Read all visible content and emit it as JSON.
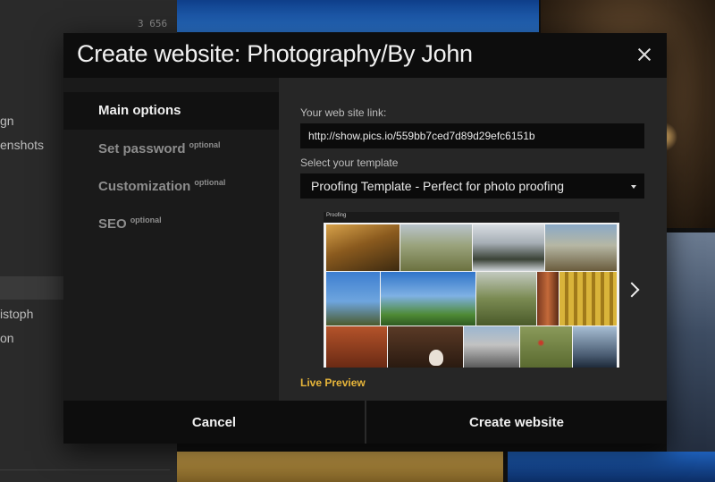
{
  "background": {
    "count": "3 656",
    "sidebar_items": [
      "gn",
      "enshots",
      "istoph",
      "on"
    ]
  },
  "dialog": {
    "title": "Create website: Photography/By John",
    "nav": [
      {
        "label": "Main options",
        "optional": ""
      },
      {
        "label": "Set password",
        "optional": "optional"
      },
      {
        "label": "Customization",
        "optional": "optional"
      },
      {
        "label": "SEO",
        "optional": "optional"
      }
    ],
    "link_label": "Your web site link:",
    "link_value": "http://show.pics.io/559bb7ced7d89d29efc6151b",
    "template_label": "Select your template",
    "template_value": "Proofing Template - Perfect for photo proofing",
    "preview_label": "Proofing",
    "live_preview": "Live Preview",
    "cancel": "Cancel",
    "create": "Create website"
  },
  "colors": {
    "accent": "#e8b63a",
    "header_bg": "#0d0d0d",
    "panel_bg": "#262626"
  }
}
